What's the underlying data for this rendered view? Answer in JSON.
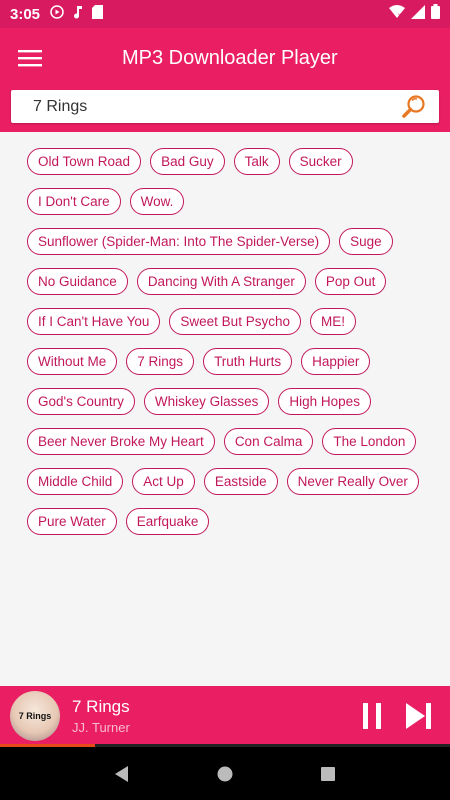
{
  "status_bar": {
    "time": "3:05",
    "left_icons": [
      "play-circle-icon",
      "music-note-icon",
      "sd-card-icon"
    ],
    "right_icons": [
      "wifi-icon",
      "signal-icon",
      "battery-icon"
    ]
  },
  "app_bar": {
    "title": "MP3 Downloader Player",
    "menu_icon": "hamburger-menu-icon"
  },
  "search": {
    "value": "7 Rings",
    "icon": "search-icon"
  },
  "tags": [
    "Old Town Road",
    "Bad Guy",
    "Talk",
    "Sucker",
    "I Don't Care",
    "Wow.",
    "Sunflower (Spider-Man: Into The Spider-Verse)",
    "Suge",
    "No Guidance",
    "Dancing With A Stranger",
    "Pop Out",
    "If I Can't Have You",
    "Sweet But Psycho",
    "ME!",
    "Without Me",
    "7 Rings",
    "Truth Hurts",
    "Happier",
    "God's Country",
    "Whiskey Glasses",
    "High Hopes",
    "Beer Never Broke My Heart",
    "Con Calma",
    "The London",
    "Middle Child",
    "Act Up",
    "Eastside",
    "Never Really Over",
    "Pure Water",
    "Earfquake"
  ],
  "player": {
    "album_art_text": "7 Rings",
    "title": "7 Rings",
    "artist": "JJ. Turner",
    "progress": 0.21
  },
  "colors": {
    "primary": "#e91e63",
    "status": "#d81b60",
    "tag_border": "#c2185b",
    "search_icon": "#e87722",
    "progress": "#e64a19"
  }
}
